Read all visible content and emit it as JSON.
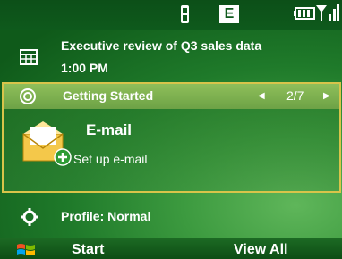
{
  "status_bar": {
    "network_badge": "E",
    "icons": [
      "phone-icon",
      "battery-icon",
      "signal-icon"
    ]
  },
  "appointment": {
    "title": "Executive review of Q3 sales data",
    "time": "1:00 PM",
    "icon": "calendar-icon"
  },
  "getting_started": {
    "label": "Getting Started",
    "pager": "2/7",
    "item_title": "E-mail",
    "item_subtitle": "Set up e-mail",
    "icon": "email-setup-icon"
  },
  "profile": {
    "label": "Profile: Normal",
    "icon": "gear-icon"
  },
  "softkeys": {
    "left": "Start",
    "right": "View All"
  },
  "colors": {
    "highlight_border": "#d8c44a",
    "header_bar": "#6da246",
    "status_bg": "#0e5a1c"
  }
}
